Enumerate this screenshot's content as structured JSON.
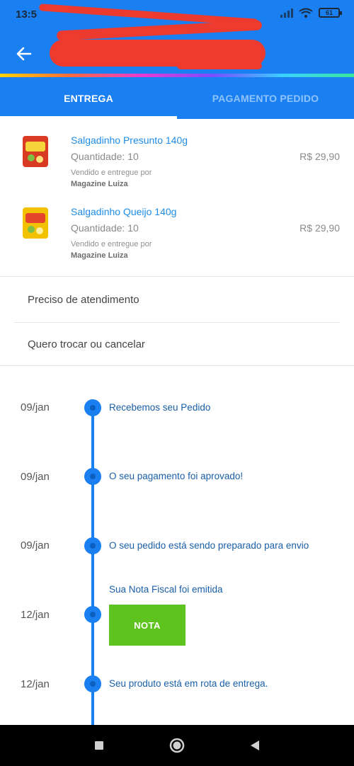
{
  "status_bar": {
    "time": "13:5",
    "battery": "61"
  },
  "header": {
    "back_icon": "arrow-left-icon",
    "tabs": [
      {
        "label": "ENTREGA",
        "active": true
      },
      {
        "label": "PAGAMENTO PEDIDO",
        "active": false
      }
    ]
  },
  "products": [
    {
      "name": "Salgadinho Presunto 140g",
      "quantity": "Quantidade: 10",
      "price": "R$ 29,90",
      "sold_by": "Vendido e entregue por",
      "seller": "Magazine Luiza",
      "image_color": "#d83a22"
    },
    {
      "name": "Salgadinho Queijo 140g",
      "quantity": "Quantidade: 10",
      "price": "R$ 29,90",
      "sold_by": "Vendido e entregue por",
      "seller": "Magazine Luiza",
      "image_color": "#f2c200"
    }
  ],
  "actions": [
    {
      "label": "Preciso de atendimento"
    },
    {
      "label": "Quero trocar ou cancelar"
    }
  ],
  "timeline": [
    {
      "date": "09/jan",
      "text": "Recebemos seu Pedido"
    },
    {
      "date": "09/jan",
      "text": "O seu pagamento foi aprovado!"
    },
    {
      "date": "09/jan",
      "text": "O seu pedido está sendo preparado para envio"
    },
    {
      "date": "12/jan",
      "text": "Sua Nota Fiscal foi emitida",
      "button": "NOTA"
    },
    {
      "date": "12/jan",
      "text": "Seu produto está em rota de entrega."
    }
  ],
  "colors": {
    "primary": "#1a7ff0",
    "link": "#1e8ce6",
    "button_green": "#5fc31f",
    "redaction": "#ee3b2f"
  },
  "navbar": {
    "icons": [
      "square-icon",
      "circle-home-icon",
      "triangle-back-icon"
    ]
  }
}
